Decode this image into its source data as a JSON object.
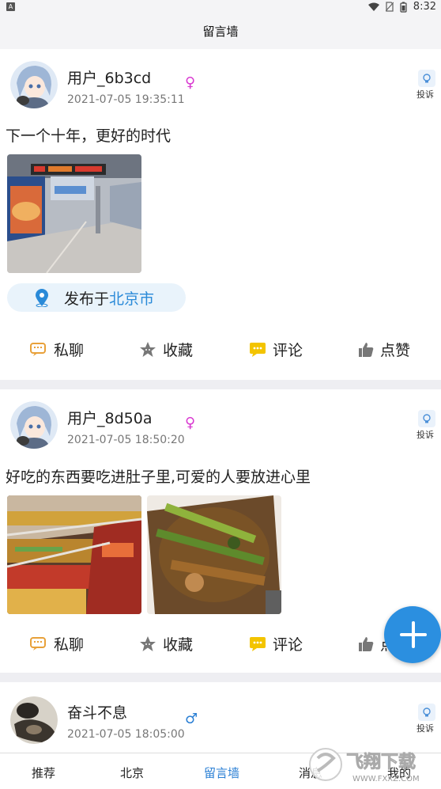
{
  "statusbar": {
    "time": "8:32"
  },
  "header": {
    "title": "留言墙"
  },
  "posts": [
    {
      "username": "用户_6b3cd",
      "datetime": "2021-07-05 19:35:11",
      "gender": "♀",
      "report_label": "投诉",
      "content": "下一个十年，更好的时代",
      "location_prefix": "发布于",
      "location_city": "北京市"
    },
    {
      "username": "用户_8d50a",
      "datetime": "2021-07-05 18:50:20",
      "gender": "♀",
      "report_label": "投诉",
      "content": "好吃的东西要吃进肚子里,可爱的人要放进心里"
    },
    {
      "username": "奋斗不息",
      "datetime": "2021-07-05 18:05:00",
      "gender": "♂",
      "report_label": "投诉"
    }
  ],
  "actions": {
    "message": "私聊",
    "favorite": "收藏",
    "comment": "评论",
    "like": "点赞"
  },
  "actions_post2_like_partial": "点",
  "tabs": [
    {
      "label": "推荐"
    },
    {
      "label": "北京"
    },
    {
      "label": "留言墙"
    },
    {
      "label": "消息"
    },
    {
      "label": "我的"
    }
  ],
  "watermark": {
    "text": "飞翔下载",
    "url": "WWW.FXXZ.COM"
  },
  "colors": {
    "accent": "#2b8fe0",
    "female": "#d93ad1",
    "male": "#2a7fd4",
    "comment_icon": "#f3c400"
  }
}
